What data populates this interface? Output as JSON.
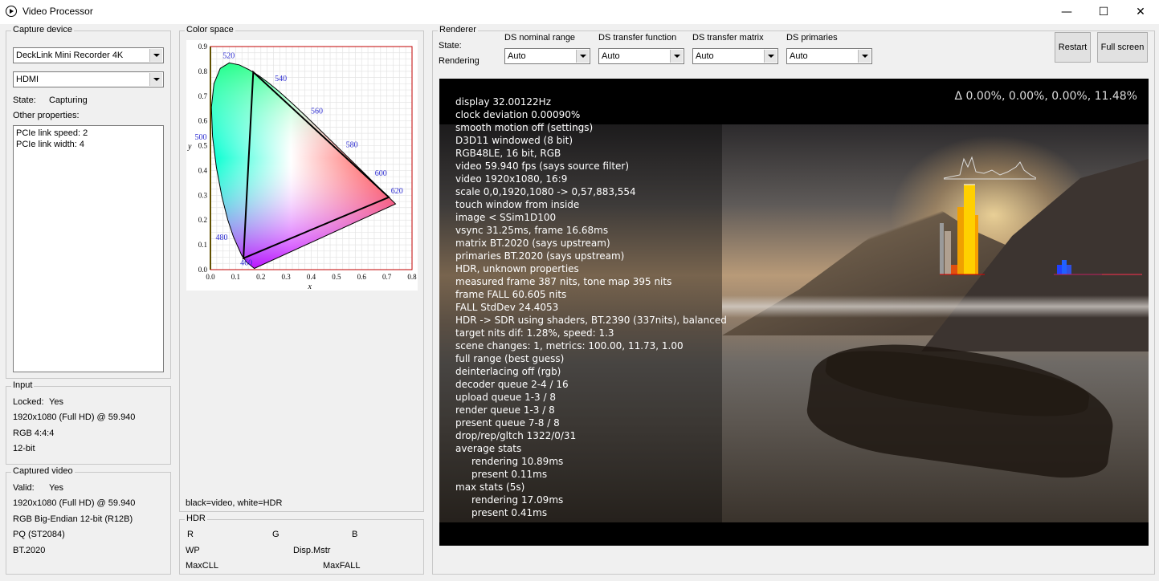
{
  "window": {
    "title": "Video Processor",
    "minimize": "—",
    "maximize": "☐",
    "close": "✕"
  },
  "capture": {
    "title": "Capture device",
    "device": "DeckLink Mini Recorder 4K",
    "input": "HDMI",
    "state_label": "State:",
    "state_value": "Capturing",
    "other_label": "Other properties:",
    "properties": [
      "PCIe link speed: 2",
      "PCIe link width: 4"
    ]
  },
  "input": {
    "title": "Input",
    "locked_label": "Locked:",
    "locked_value": "Yes",
    "lines": [
      "1920x1080 (Full HD) @ 59.940",
      "RGB 4:4:4",
      "12-bit"
    ]
  },
  "captured": {
    "title": "Captured video",
    "valid_label": "Valid:",
    "valid_value": "Yes",
    "lines": [
      "1920x1080 (Full HD) @ 59.940",
      "RGB Big-Endian 12-bit (R12B)",
      "PQ (ST2084)",
      "BT.2020"
    ]
  },
  "colorspace": {
    "title": "Color space",
    "note": "black=video, white=HDR",
    "chart_data": {
      "type": "scatter",
      "title": "",
      "xlabel": "x",
      "ylabel": "y",
      "xlim": [
        0.0,
        0.8
      ],
      "ylim": [
        0.0,
        0.9
      ],
      "xticks": [
        "0.0",
        "0.1",
        "0.2",
        "0.3",
        "0.4",
        "0.5",
        "0.6",
        "0.7",
        "0.8"
      ],
      "yticks": [
        "0.0",
        "0.1",
        "0.2",
        "0.3",
        "0.4",
        "0.5",
        "0.6",
        "0.7",
        "0.8",
        "0.9"
      ],
      "wavelength_labels": [
        {
          "nm": "460",
          "x": 0.144,
          "y": 0.03
        },
        {
          "nm": "480",
          "x": 0.091,
          "y": 0.133
        },
        {
          "nm": "500",
          "x": 0.008,
          "y": 0.538
        },
        {
          "nm": "520",
          "x": 0.074,
          "y": 0.834
        },
        {
          "nm": "540",
          "x": 0.23,
          "y": 0.754
        },
        {
          "nm": "560",
          "x": 0.373,
          "y": 0.624
        },
        {
          "nm": "580",
          "x": 0.512,
          "y": 0.487
        },
        {
          "nm": "600",
          "x": 0.627,
          "y": 0.373
        },
        {
          "nm": "620",
          "x": 0.691,
          "y": 0.308
        }
      ],
      "gamut_triangle": [
        [
          0.708,
          0.292
        ],
        [
          0.17,
          0.797
        ],
        [
          0.131,
          0.046
        ]
      ]
    }
  },
  "hdr": {
    "title": "HDR",
    "r": "R",
    "g": "G",
    "b": "B",
    "wp": "WP",
    "disp": "Disp.Mstr",
    "maxcll": "MaxCLL",
    "maxfall": "MaxFALL"
  },
  "renderer": {
    "title": "Renderer",
    "state_label": "State:",
    "state_value": "Rendering",
    "dropdowns": [
      {
        "label": "DS nominal range",
        "value": "Auto"
      },
      {
        "label": "DS transfer function",
        "value": "Auto"
      },
      {
        "label": "DS transfer matrix",
        "value": "Auto"
      },
      {
        "label": "DS primaries",
        "value": "Auto"
      }
    ],
    "restart": "Restart",
    "fullscreen": "Full screen"
  },
  "osd": {
    "delta": "Δ 0.00%, 0.00%, 0.00%, 11.48%",
    "lines": [
      "display 32.00122Hz",
      "clock deviation 0.00090%",
      "smooth motion off (settings)",
      "D3D11 windowed (8 bit)",
      "RGB48LE, 16 bit, RGB",
      "video 59.940 fps  (says source filter)",
      "video 1920x1080, 16:9",
      "scale 0,0,1920,1080 -> 0,57,883,554",
      "touch window from inside",
      "image < SSim1D100",
      "vsync 31.25ms, frame 16.68ms",
      "matrix BT.2020 (says upstream)",
      "primaries BT.2020 (says upstream)",
      "HDR, unknown properties",
      "measured frame 387 nits, tone map 395 nits",
      "frame FALL 60.605 nits",
      "FALL StdDev 24.4053",
      "HDR -> SDR using shaders, BT.2390 (337nits), balanced",
      "target nits dif: 1.28%, speed: 1.3",
      "scene changes: 1, metrics: 100.00, 11.73, 1.00",
      "full range (best guess)",
      "deinterlacing off (rgb)",
      "decoder queue 2-4 / 16",
      "upload queue 1-3 / 8",
      "render queue 1-3 / 8",
      "present queue 7-8 / 8",
      "drop/rep/gltch 1322/0/31",
      "average stats",
      "rendering 10.89ms",
      "present 0.11ms",
      "max stats (5s)",
      "rendering 17.09ms",
      "present 0.41ms"
    ],
    "indented": [
      28,
      29,
      31,
      32
    ]
  }
}
